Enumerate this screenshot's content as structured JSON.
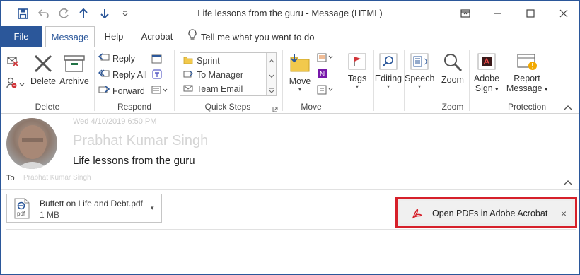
{
  "window": {
    "title": "Life lessons from the guru  -  Message (HTML)"
  },
  "quick_access": {
    "save_icon": "save-icon",
    "undo_icon": "undo-icon",
    "redo_icon": "redo-icon",
    "up_icon": "up-arrow-icon",
    "down_icon": "down-arrow-icon",
    "customize_icon": "customize-icon"
  },
  "tabs": [
    {
      "label": "File"
    },
    {
      "label": "Message"
    },
    {
      "label": "Help"
    },
    {
      "label": "Acrobat"
    },
    {
      "label": "Tell me what you want to do"
    }
  ],
  "ribbon": {
    "delete_group": {
      "label": "Delete",
      "delete": "Delete",
      "archive": "Archive"
    },
    "respond_group": {
      "label": "Respond",
      "reply": "Reply",
      "reply_all": "Reply All",
      "forward": "Forward"
    },
    "quick_steps_group": {
      "label": "Quick Steps",
      "items": [
        {
          "label": "Sprint"
        },
        {
          "label": "To Manager"
        },
        {
          "label": "Team Email"
        }
      ]
    },
    "move_group": {
      "label": "Move",
      "move": "Move"
    },
    "tags": "Tags",
    "editing": "Editing",
    "speech": "Speech",
    "zoom_group": {
      "label": "Zoom",
      "zoom": "Zoom"
    },
    "adobe_sign": [
      "Adobe",
      "Sign"
    ],
    "protection_group": {
      "label": "Protection",
      "report_message": [
        "Report",
        "Message"
      ]
    }
  },
  "message": {
    "date": "Wed 4/10/2019 6:50 PM",
    "sender": "Prabhat Kumar Singh",
    "subject": "Life lessons from the guru",
    "to_label": "To",
    "to_value": "Prabhat Kumar Singh"
  },
  "attachment": {
    "name": "Buffett on Life and Debt.pdf",
    "size": "1 MB",
    "file_type": "pdf"
  },
  "banner": {
    "text": "Open PDFs in Adobe Acrobat",
    "close": "×"
  },
  "colors": {
    "accent": "#2b579a",
    "banner_border": "#d6202a"
  }
}
